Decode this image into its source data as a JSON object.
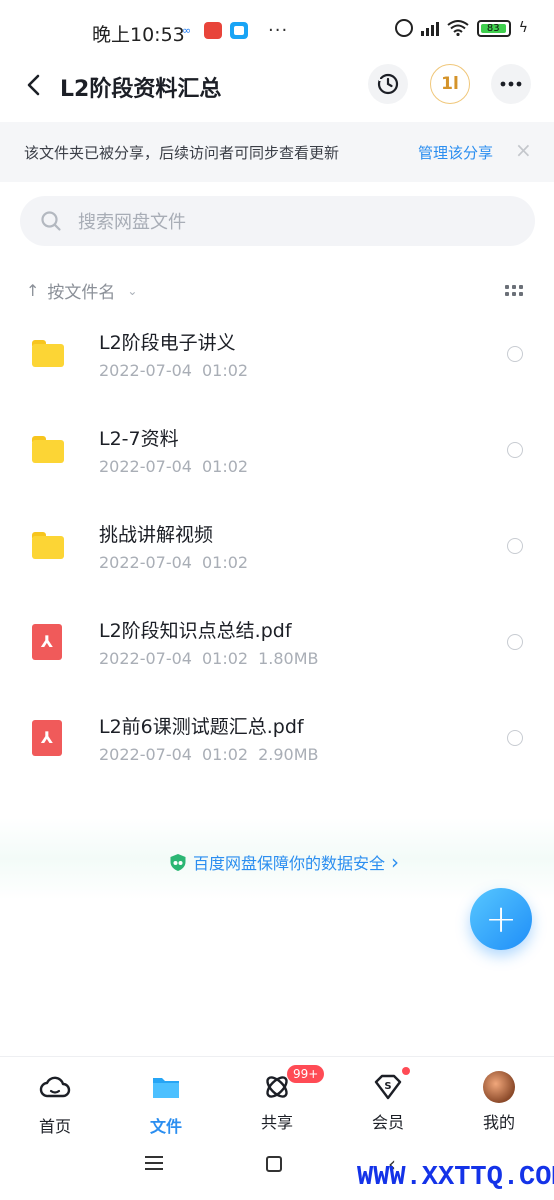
{
  "status_bar": {
    "time": "晚上10:53",
    "more": "···",
    "battery": "83"
  },
  "header": {
    "title": "L2阶段资料汇总",
    "transfer_label": "1l"
  },
  "notice": {
    "text": "该文件夹已被分享，后续访问者可同步查看更新",
    "link": "管理该分享",
    "close": "×"
  },
  "search": {
    "placeholder": "搜索网盘文件"
  },
  "sort": {
    "arrow": "↑",
    "label": "按文件名",
    "chevron": "⌄"
  },
  "files": [
    {
      "name": "L2阶段电子讲义",
      "date": "2022-07-04",
      "time": "01:02",
      "size": "",
      "type": "folder"
    },
    {
      "name": "L2-7资料",
      "date": "2022-07-04",
      "time": "01:02",
      "size": "",
      "type": "folder"
    },
    {
      "name": "挑战讲解视频",
      "date": "2022-07-04",
      "time": "01:02",
      "size": "",
      "type": "folder"
    },
    {
      "name": "L2阶段知识点总结.pdf",
      "date": "2022-07-04",
      "time": "01:02",
      "size": "1.80MB",
      "type": "pdf"
    },
    {
      "name": "L2前6课测试题汇总.pdf",
      "date": "2022-07-04",
      "time": "01:02",
      "size": "2.90MB",
      "type": "pdf"
    }
  ],
  "safety": {
    "text": "百度网盘保障你的数据安全",
    "chevron": "›"
  },
  "fab": {
    "label": "+"
  },
  "bottom_nav": [
    {
      "label": "首页",
      "icon": "cloud-home-icon"
    },
    {
      "label": "文件",
      "icon": "folder-icon",
      "active": true
    },
    {
      "label": "共享",
      "icon": "share-atom-icon",
      "badge": "99+"
    },
    {
      "label": "会员",
      "icon": "vip-diamond-icon",
      "dot": true
    },
    {
      "label": "我的",
      "icon": "avatar"
    }
  ],
  "watermark": "WWW.XXTTQ.COM",
  "colors": {
    "accent": "#2b8ef0",
    "folder": "#fcd535",
    "pdf": "#f05a5a",
    "badge": "#ff4b55"
  }
}
